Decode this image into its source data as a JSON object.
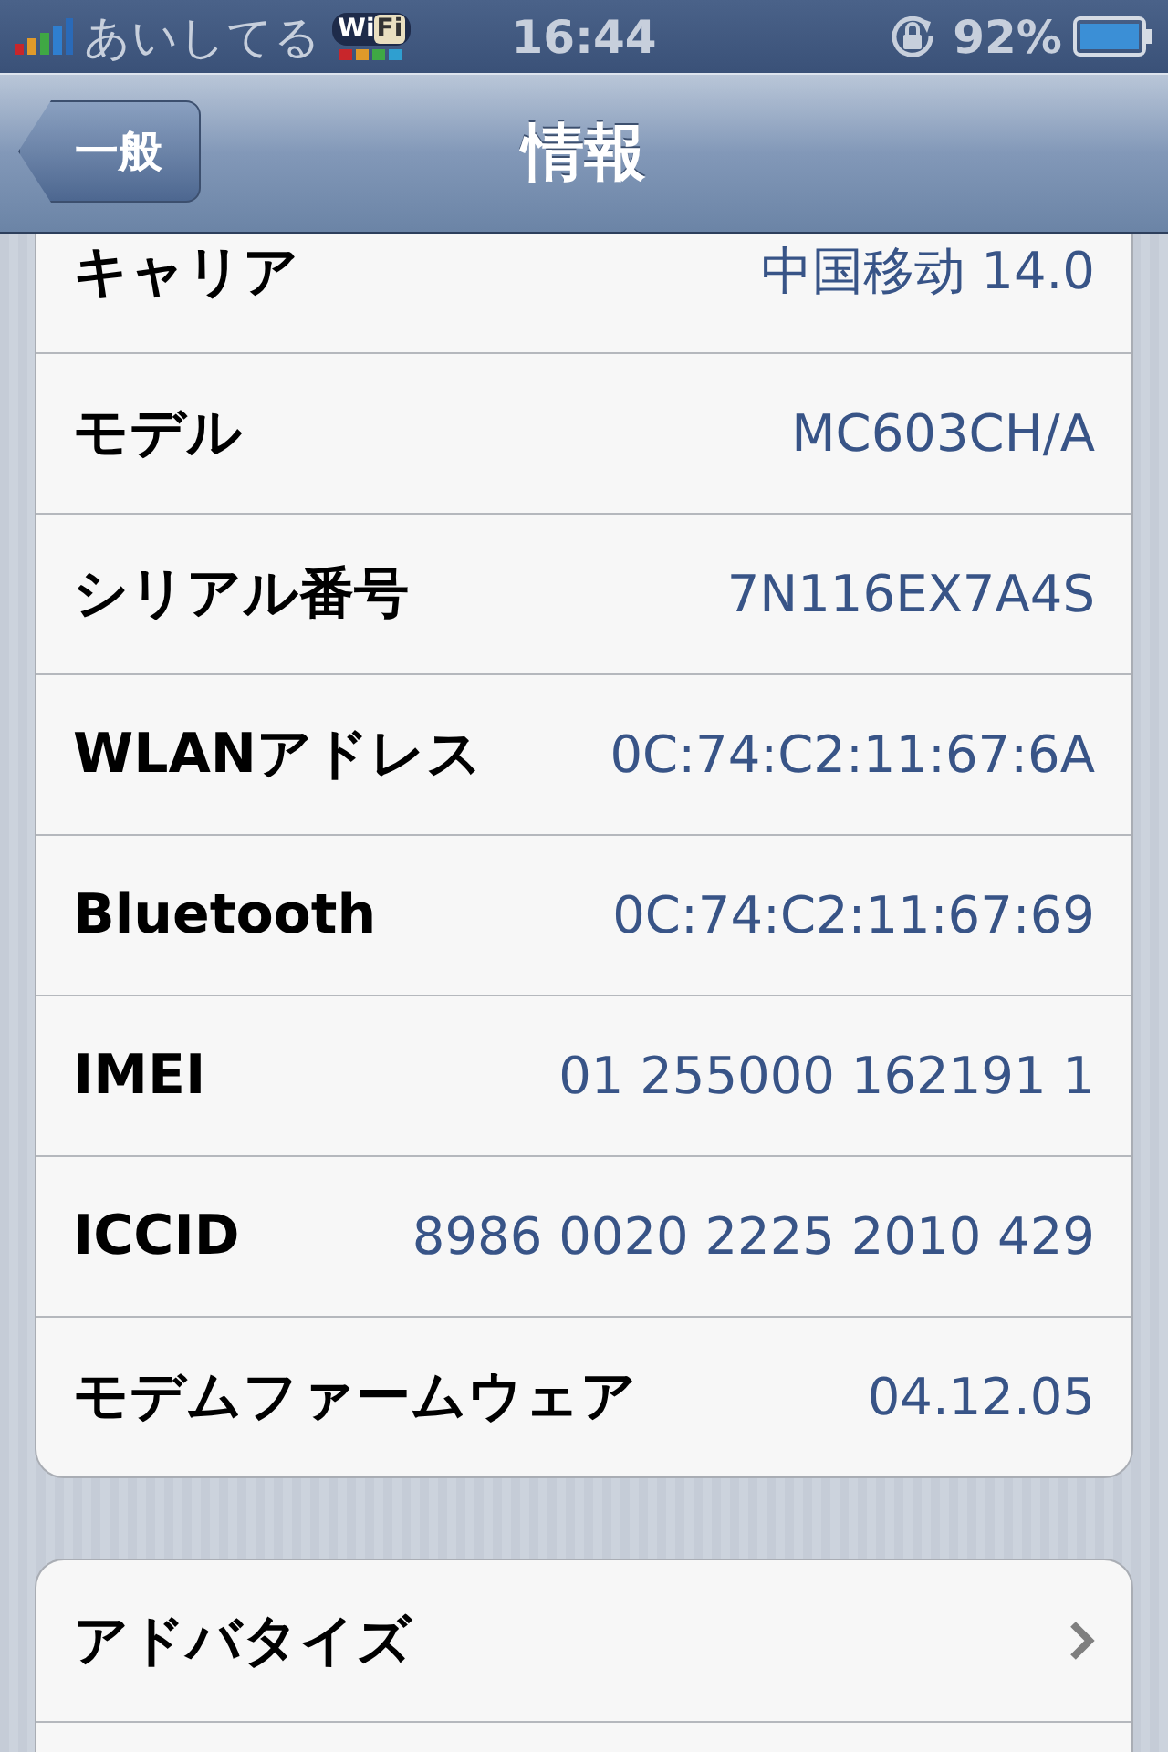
{
  "status_bar": {
    "carrier": "あいしてる",
    "wifi_badge": [
      "Wi",
      "Fi"
    ],
    "time": "16:44",
    "battery": "92%"
  },
  "nav_bar": {
    "back": "一般",
    "title": "情報"
  },
  "groups": [
    {
      "rows": [
        {
          "kind": "info",
          "label": "キャリア",
          "value": "中国移动 14.0"
        },
        {
          "kind": "info",
          "label": "モデル",
          "value": "MC603CH/A"
        },
        {
          "kind": "info",
          "label": "シリアル番号",
          "value": "7N116EX7A4S"
        },
        {
          "kind": "info",
          "label": "WLANアドレス",
          "value": "0C:74:C2:11:67:6A"
        },
        {
          "kind": "info",
          "label": "Bluetooth",
          "value": "0C:74:C2:11:67:69"
        },
        {
          "kind": "info",
          "label": "IMEI",
          "value": "01 255000 162191 1"
        },
        {
          "kind": "info",
          "label": "ICCID",
          "value": "8986 0020 2225 2010 429"
        },
        {
          "kind": "info",
          "label": "モデムファームウェア",
          "value": "04.12.05"
        }
      ]
    },
    {
      "rows": [
        {
          "kind": "link",
          "label": "アドバタイズ"
        },
        {
          "kind": "blank"
        }
      ]
    }
  ]
}
